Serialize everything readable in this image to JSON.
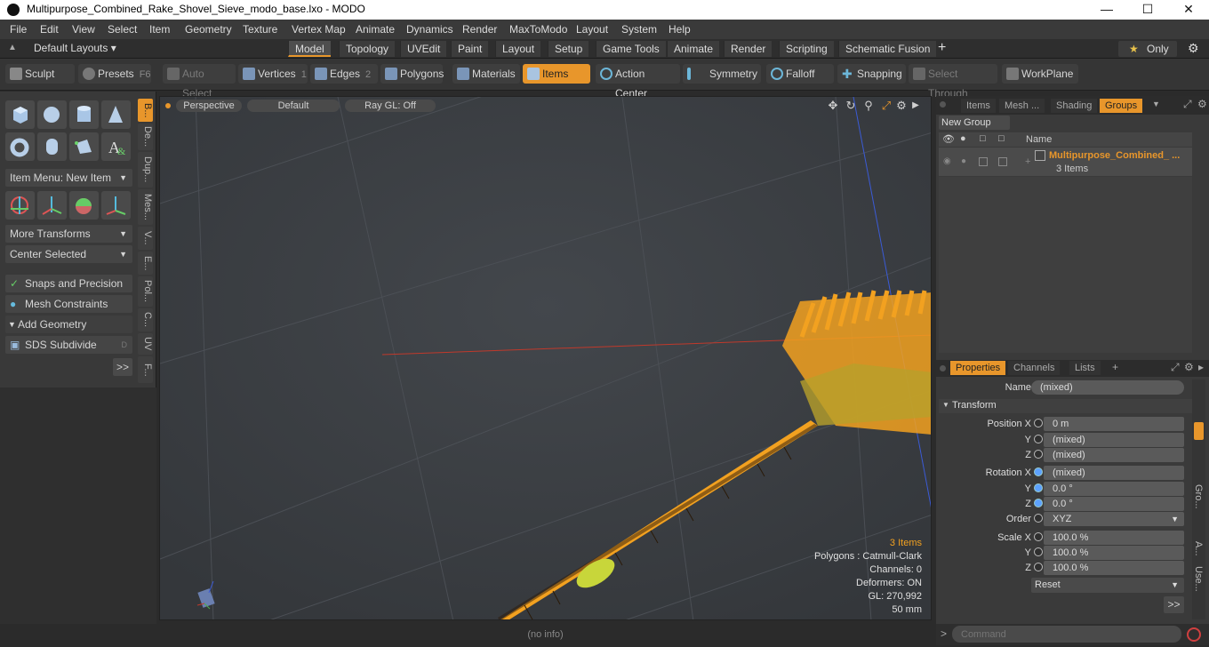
{
  "window": {
    "title": "Multipurpose_Combined_Rake_Shovel_Sieve_modo_base.lxo - MODO"
  },
  "menu": [
    "File",
    "Edit",
    "View",
    "Select",
    "Item",
    "Geometry",
    "Texture",
    "Vertex Map",
    "Animate",
    "Dynamics",
    "Render",
    "MaxToModo",
    "Layout",
    "System",
    "Help"
  ],
  "layouts": {
    "dropdown": "Default Layouts",
    "tabs": [
      "Model",
      "Topology",
      "UVEdit",
      "Paint",
      "Layout",
      "Setup",
      "Game Tools",
      "Animate",
      "Render",
      "Scripting",
      "Schematic Fusion"
    ],
    "active": "Model",
    "add": "+",
    "only_label": "Only"
  },
  "toolbar": {
    "sculpt": "Sculpt",
    "presets": "Presets",
    "presets_key": "F6",
    "auto_select": "Auto Select",
    "vertices": "Vertices",
    "vertices_key": "1",
    "edges": "Edges",
    "edges_key": "2",
    "polygons": "Polygons",
    "materials": "Materials",
    "items": "Items",
    "action_center": "Action Center",
    "symmetry": "Symmetry",
    "falloff": "Falloff",
    "snapping": "Snapping",
    "select_through": "Select Through",
    "workplane": "WorkPlane"
  },
  "left": {
    "item_menu": "Item Menu: New Item",
    "more_transforms": "More Transforms",
    "center_selected": "Center Selected",
    "snaps": "Snaps and Precision",
    "mesh_constraints": "Mesh Constraints",
    "add_geometry": "Add Geometry",
    "sds": "SDS Subdivide",
    "sds_key": "D",
    "more": ">>",
    "vtabs": [
      "B...",
      "De...",
      "Dup...",
      "Mes...",
      "V...",
      "E...",
      "Pol...",
      "C...",
      "UV",
      "F..."
    ]
  },
  "viewport": {
    "view": "Perspective",
    "shading": "Default",
    "raygl": "Ray GL: Off",
    "info": {
      "items": "3 Items",
      "polygons": "Polygons : Catmull-Clark",
      "channels": "Channels: 0",
      "deformers": "Deformers: ON",
      "gl": "GL: 270,992",
      "scale": "50 mm"
    },
    "status": "(no info)"
  },
  "groups_panel": {
    "tabs": [
      "Items",
      "Mesh ...",
      "Shading",
      "Groups"
    ],
    "active": "Groups",
    "new_group": "New Group",
    "name_col": "Name",
    "row_name": "Multipurpose_Combined_ ...",
    "row_sub": "3 Items"
  },
  "properties": {
    "tabs": [
      "Properties",
      "Channels",
      "Lists"
    ],
    "name_label": "Name",
    "name_value": "(mixed)",
    "transform": "Transform",
    "pos_label": "Position X",
    "pos": [
      "0 m",
      "(mixed)",
      "(mixed)"
    ],
    "rot_label": "Rotation X",
    "rot": [
      "(mixed)",
      "0.0 °",
      "0.0 °"
    ],
    "order_label": "Order",
    "order": "XYZ",
    "scale_label": "Scale X",
    "scale": [
      "100.0 %",
      "100.0 %",
      "100.0 %"
    ],
    "y": "Y",
    "z": "Z",
    "reset": "Reset",
    "more": ">>",
    "side_tabs": [
      "Gro...",
      "A...",
      "Use..."
    ]
  },
  "command": {
    "placeholder": "Command",
    "prompt": ">"
  },
  "colors": {
    "accent": "#e8962b",
    "mesh": "#f2a120",
    "selected_mesh": "#c8d63a"
  }
}
